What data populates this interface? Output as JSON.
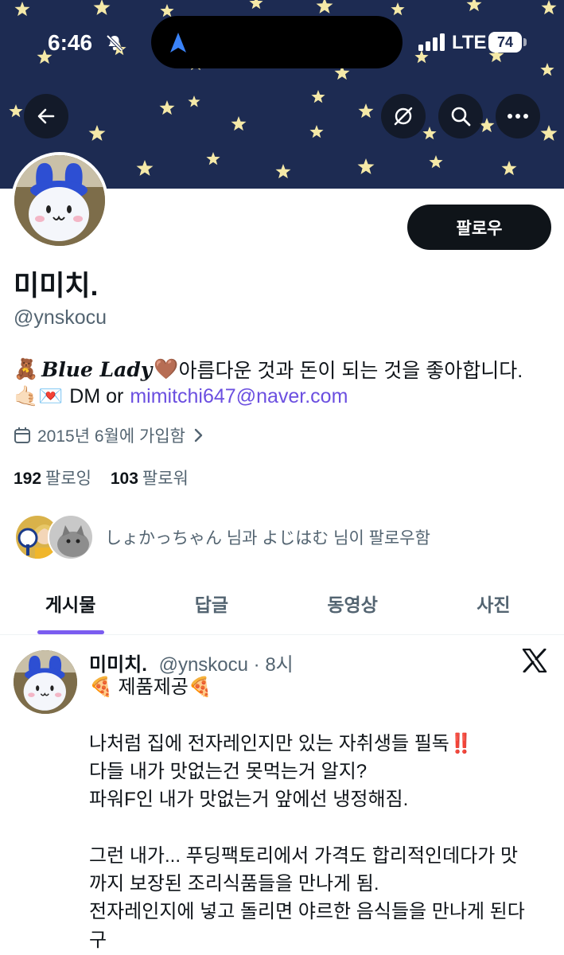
{
  "status_bar": {
    "time": "6:46",
    "network": "LTE",
    "battery": "74"
  },
  "colors": {
    "banner_bg": "#1d2b52",
    "star": "#f5e9a8",
    "accent": "#7b5cf0",
    "link": "#6b4fe0"
  },
  "banner_icons": [
    "back-arrow-icon",
    "grok-icon",
    "search-icon",
    "more-icon"
  ],
  "profile": {
    "follow_button": "팔로우",
    "name": "미미치.",
    "handle": "@ynskocu",
    "bio_line1_emoji": "🧸",
    "bio_line1_fancy": "Blue Lady",
    "bio_line1_heart": "🤎",
    "bio_line1_text": "아름다운 것과 돈이 되는 것을 좋아합니다.",
    "bio_line2_emoji": "🤙🏻💌",
    "bio_line2_text": "DM or",
    "bio_email": "mimitchi647@naver.com",
    "joined": "2015년 6월에 가입함",
    "following_count": "192",
    "following_label": "팔로잉",
    "followers_count": "103",
    "followers_label": "팔로워",
    "followed_by": "しょかっちゃん 님과 よじはむ 님이 팔로우함"
  },
  "tabs": [
    {
      "label": "게시물",
      "active": true
    },
    {
      "label": "답글",
      "active": false
    },
    {
      "label": "동영상",
      "active": false
    },
    {
      "label": "사진",
      "active": false
    }
  ],
  "tweet": {
    "name": "미미치.",
    "handle_time": "@ynskocu · 8시",
    "body": "🍕 제품제공🍕\n\n나처럼 집에 전자레인지만 있는 자취생들 필독‼️\n다들 내가 맛없는건 못먹는거 알지?\n파워F인 내가 맛없는거 앞에선 냉정해짐.\n\n그런 내가... 푸딩팩토리에서 가격도 합리적인데다가 맛\n까지 보장된 조리식품들을 만나게 됨.\n전자레인지에 넣고 돌리면 야르한 음식들을 만나게 된다\n구"
  }
}
